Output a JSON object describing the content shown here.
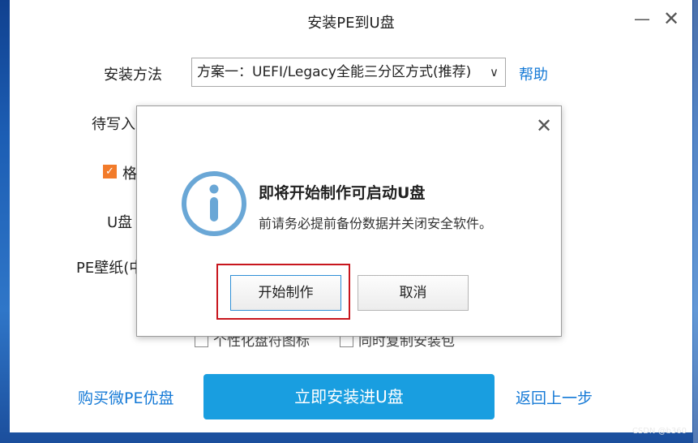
{
  "window": {
    "title": "安装PE到U盘",
    "minimize_glyph": "—",
    "close_glyph": "✕"
  },
  "form": {
    "install_method_label": "安装方法",
    "install_method_value": "方案一：UEFI/Legacy全能三分区方式(推荐)",
    "help_label": "帮助",
    "pending_write_label": "待写入",
    "format_label": "格",
    "format_checked": true,
    "udisk_label": "U盘",
    "pe_wallpaper_label": "PE壁纸(中",
    "option1_label": "个性化盘符图标",
    "option2_label": "同时复制安装包"
  },
  "footer": {
    "buy_link": "购买微PE优盘",
    "install_button": "立即安装进U盘",
    "back_link": "返回上一步"
  },
  "dialog": {
    "close_glyph": "✕",
    "title": "即将开始制作可启动U盘",
    "message": "前请务必提前备份数据并关闭安全软件。",
    "start_button": "开始制作",
    "cancel_button": "取消"
  },
  "colors": {
    "accent_blue": "#199ee0",
    "link_blue": "#1479d6",
    "checkbox_orange": "#f27b2a",
    "highlight_red": "#c8161d",
    "info_icon": "#6aa7d6"
  },
  "watermark": "CSDN @b360"
}
